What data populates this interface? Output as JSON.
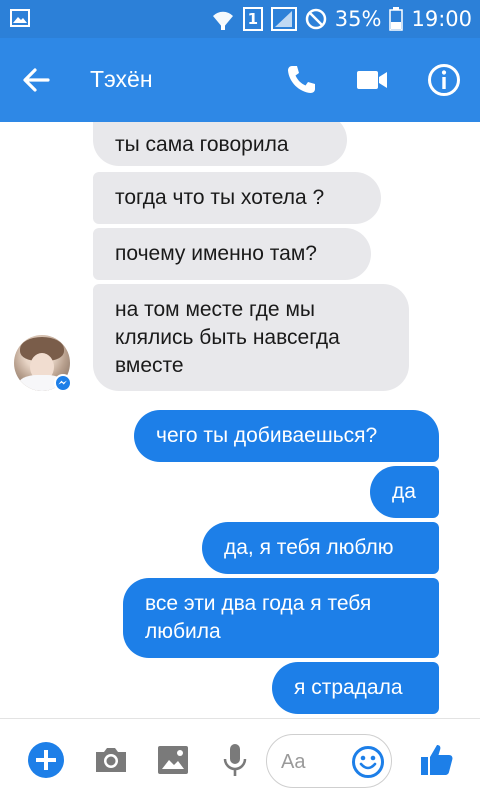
{
  "status_bar": {
    "battery": "35%",
    "time": "19:00",
    "sim_label": "1"
  },
  "header": {
    "contact_name": "Тэхён"
  },
  "messages": [
    {
      "direction": "in",
      "text": "ты сама говорила"
    },
    {
      "direction": "in",
      "text": "тогда что ты хотела ?"
    },
    {
      "direction": "in",
      "text": "почему именно там?"
    },
    {
      "direction": "in",
      "text": "на том месте где мы\nклялись быть навсегда\nвместе"
    },
    {
      "direction": "out",
      "text": "чего ты добиваешься?"
    },
    {
      "direction": "out",
      "text": "да"
    },
    {
      "direction": "out",
      "text": "да, я тебя люблю"
    },
    {
      "direction": "out",
      "text": "все эти два года я тебя\nлюбила"
    },
    {
      "direction": "out",
      "text": "я страдала"
    }
  ],
  "composer": {
    "placeholder": "Aa"
  },
  "colors": {
    "header": "#2e88e6",
    "status_bar": "#2c80d8",
    "outgoing_bubble": "#1d7fe8",
    "incoming_bubble": "#e8e8eb",
    "accent": "#1d7fe8"
  },
  "icons": {
    "status": [
      "image-icon",
      "wifi-icon",
      "sim-icon",
      "signal-icon",
      "do-not-disturb-icon",
      "battery-icon"
    ],
    "header": [
      "back-arrow-icon",
      "phone-icon",
      "video-camera-icon",
      "info-icon"
    ],
    "composer": [
      "plus-icon",
      "camera-icon",
      "gallery-icon",
      "microphone-icon",
      "emoji-icon",
      "thumbs-up-icon"
    ]
  }
}
